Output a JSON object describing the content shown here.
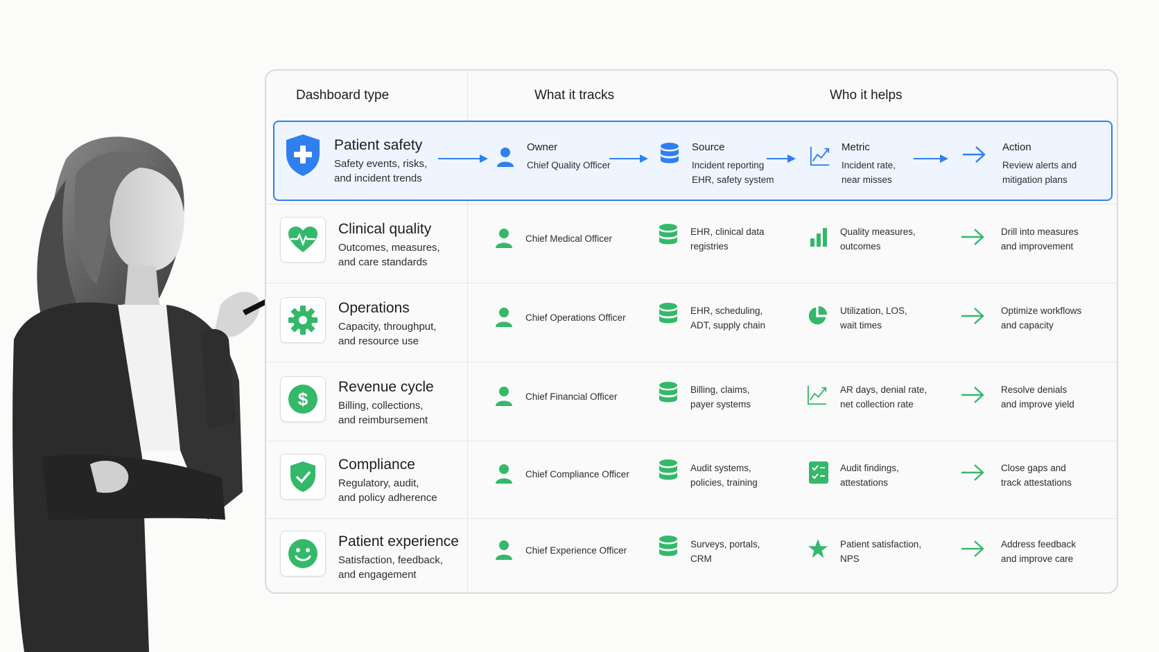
{
  "colors": {
    "accent_blue": "#2f7ff0",
    "accent_green": "#34b86a",
    "highlight_bg": "#eef5fe"
  },
  "header": {
    "col1": "Dashboard type",
    "col2": "What it tracks",
    "col3": "Who it helps"
  },
  "highlight": {
    "title": "Patient safety",
    "desc_line1": "Safety events, risks,",
    "desc_line2": "and incident trends",
    "owner_label": "Owner",
    "owner": "Chief Quality Officer",
    "source_label": "Source",
    "source_line1": "Incident reporting",
    "source_line2": "EHR, safety system",
    "metric_label": "Metric",
    "metric_line1": "Incident rate,",
    "metric_line2": "near misses",
    "action_label": "Action",
    "action_line1": "Review alerts and",
    "action_line2": "mitigation plans"
  },
  "rows": [
    {
      "title": "Clinical quality",
      "desc_line1": "Outcomes, measures,",
      "desc_line2": "and care standards",
      "owner": "Chief Medical Officer",
      "source_line1": "EHR, clinical data",
      "source_line2": "registries",
      "metric_line1": "Quality measures,",
      "metric_line2": "outcomes",
      "action_line1": "Drill into measures",
      "action_line2": "and improvement",
      "icon": "heart-pulse-icon",
      "metric_icon": "bar-chart-icon"
    },
    {
      "title": "Operations",
      "desc_line1": "Capacity, throughput,",
      "desc_line2": "and resource use",
      "owner": "Chief Operations Officer",
      "source_line1": "EHR, scheduling,",
      "source_line2": "ADT, supply chain",
      "metric_line1": "Utilization, LOS,",
      "metric_line2": "wait times",
      "action_line1": "Optimize workflows",
      "action_line2": "and capacity",
      "icon": "gear-icon",
      "metric_icon": "pie-chart-icon"
    },
    {
      "title": "Revenue cycle",
      "desc_line1": "Billing, collections,",
      "desc_line2": "and reimbursement",
      "owner": "Chief Financial Officer",
      "source_line1": "Billing, claims,",
      "source_line2": "payer systems",
      "metric_line1": "AR days, denial rate,",
      "metric_line2": "net collection rate",
      "action_line1": "Resolve denials",
      "action_line2": "and improve yield",
      "icon": "dollar-icon",
      "metric_icon": "trend-chart-icon"
    },
    {
      "title": "Compliance",
      "desc_line1": "Regulatory, audit,",
      "desc_line2": "and policy adherence",
      "owner": "Chief Compliance Officer",
      "source_line1": "Audit systems,",
      "source_line2": "policies, training",
      "metric_line1": "Audit findings,",
      "metric_line2": "attestations",
      "action_line1": "Close gaps and",
      "action_line2": "track attestations",
      "icon": "shield-check-icon",
      "metric_icon": "checklist-icon"
    },
    {
      "title": "Patient experience",
      "desc_line1": "Satisfaction, feedback,",
      "desc_line2": "and engagement",
      "owner": "Chief Experience Officer",
      "source_line1": "Surveys, portals,",
      "source_line2": "CRM",
      "metric_line1": "Patient satisfaction,",
      "metric_line2": "NPS",
      "action_line1": "Address feedback",
      "action_line2": "and improve care",
      "icon": "smiley-icon",
      "metric_icon": "star-icon"
    }
  ]
}
